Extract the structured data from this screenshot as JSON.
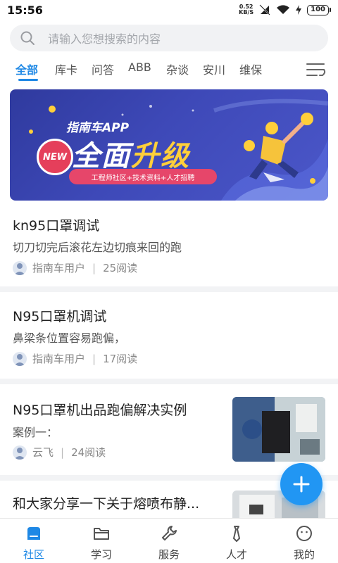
{
  "status_bar": {
    "time": "15:56",
    "net_speed_value": "0.52",
    "net_speed_unit": "KB/S",
    "battery": "100"
  },
  "search": {
    "placeholder": "请输入您想搜索的内容"
  },
  "tabs": [
    {
      "label": "全部",
      "active": true
    },
    {
      "label": "库卡",
      "active": false
    },
    {
      "label": "问答",
      "active": false
    },
    {
      "label": "ABB",
      "active": false
    },
    {
      "label": "杂谈",
      "active": false
    },
    {
      "label": "安川",
      "active": false
    },
    {
      "label": "维保",
      "active": false
    }
  ],
  "banner": {
    "app_text": "指南车APP",
    "headline_a": "全面",
    "headline_b": "升级",
    "new_badge": "NEW",
    "tagline": "工程师社区+技术资料+人才招聘"
  },
  "feed": [
    {
      "title": "kn95口罩调试",
      "summary": "切刀切完后滚花左边切痕来回的跑",
      "author": "指南车用户",
      "reads": "25阅读"
    },
    {
      "title": "N95口罩机调试",
      "summary": "鼻梁条位置容易跑偏，",
      "author": "指南车用户",
      "reads": "17阅读"
    },
    {
      "title": "N95口罩机出品跑偏解决实例",
      "summary": "案例一：",
      "author": "云飞",
      "reads": "24阅读"
    },
    {
      "title": "和大家分享一下关于熔喷布静..."
    }
  ],
  "bottom_nav": [
    {
      "label": "社区",
      "icon": "community-icon",
      "active": true
    },
    {
      "label": "学习",
      "icon": "folder-icon",
      "active": false
    },
    {
      "label": "服务",
      "icon": "wrench-icon",
      "active": false
    },
    {
      "label": "人才",
      "icon": "tie-icon",
      "active": false
    },
    {
      "label": "我的",
      "icon": "face-icon",
      "active": false
    }
  ],
  "colors": {
    "accent": "#1e88e5",
    "fab": "#2196f3",
    "banner": "#3e49b8"
  }
}
